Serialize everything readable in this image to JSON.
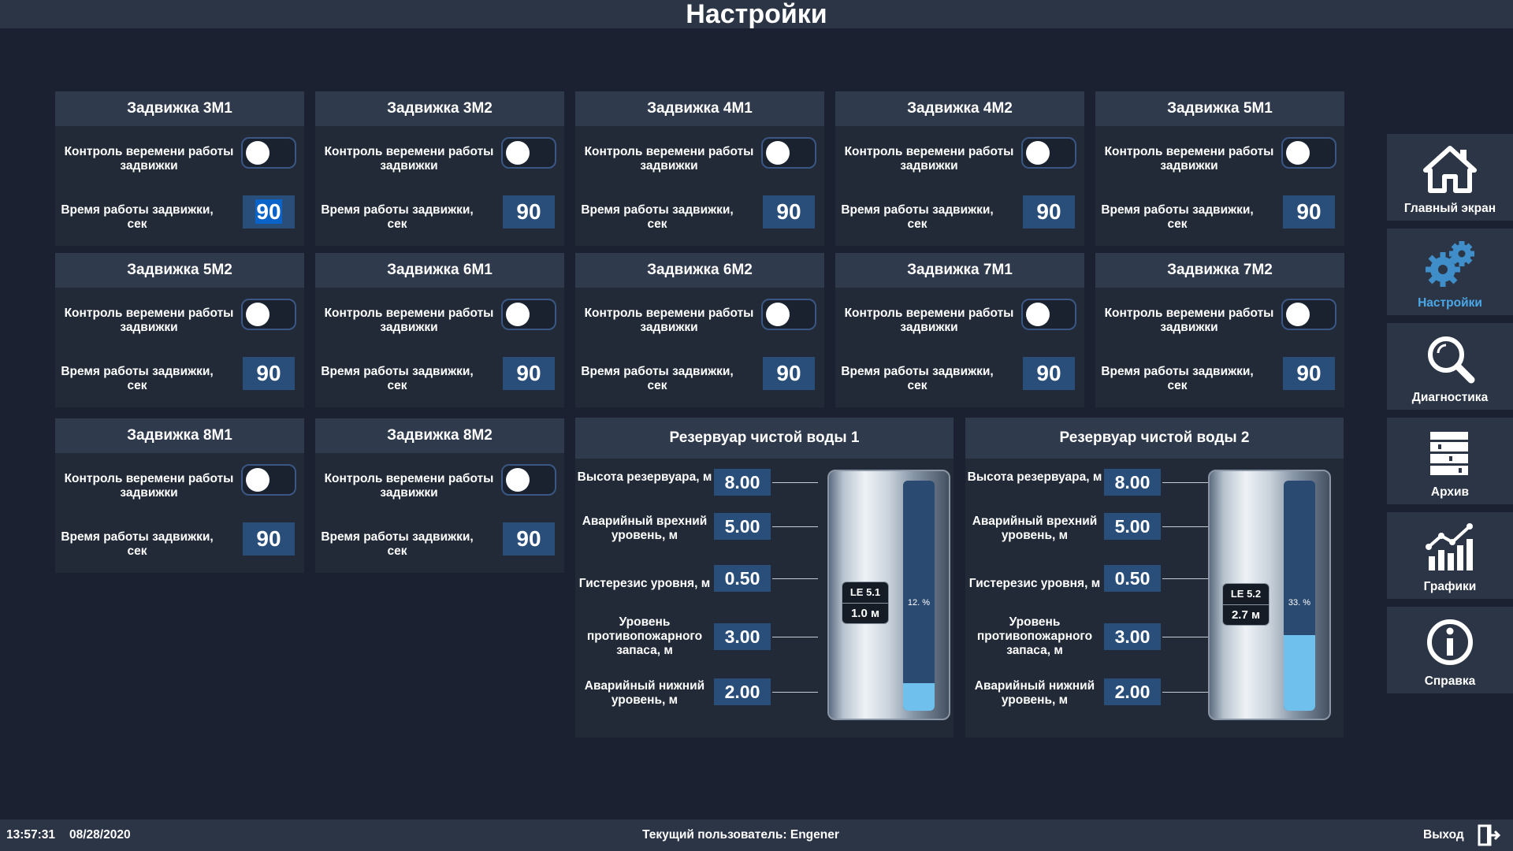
{
  "title": "Настройки",
  "valves": [
    {
      "name": "Задвижка 3М1",
      "control_label": "Контроль веремени работы задвижки",
      "time_label": "Время работы задвижки, сек",
      "time_value": "90",
      "editing": true
    },
    {
      "name": "Задвижка 3М2",
      "control_label": "Контроль веремени работы задвижки",
      "time_label": "Время работы задвижки, сек",
      "time_value": "90"
    },
    {
      "name": "Задвижка 4М1",
      "control_label": "Контроль веремени работы задвижки",
      "time_label": "Время работы задвижки, сек",
      "time_value": "90"
    },
    {
      "name": "Задвижка 4М2",
      "control_label": "Контроль веремени работы задвижки",
      "time_label": "Время работы задвижки, сек",
      "time_value": "90"
    },
    {
      "name": "Задвижка 5М1",
      "control_label": "Контроль веремени работы задвижки",
      "time_label": "Время работы задвижки, сек",
      "time_value": "90"
    },
    {
      "name": "Задвижка 5М2",
      "control_label": "Контроль веремени работы задвижки",
      "time_label": "Время работы задвижки, сек",
      "time_value": "90"
    },
    {
      "name": "Задвижка 6М1",
      "control_label": "Контроль веремени работы задвижки",
      "time_label": "Время работы задвижки, сек",
      "time_value": "90"
    },
    {
      "name": "Задвижка 6М2",
      "control_label": "Контроль веремени работы задвижки",
      "time_label": "Время работы задвижки, сек",
      "time_value": "90"
    },
    {
      "name": "Задвижка 7М1",
      "control_label": "Контроль веремени работы задвижки",
      "time_label": "Время работы задвижки, сек",
      "time_value": "90"
    },
    {
      "name": "Задвижка 7М2",
      "control_label": "Контроль веремени работы задвижки",
      "time_label": "Время работы задвижки, сек",
      "time_value": "90"
    },
    {
      "name": "Задвижка 8М1",
      "control_label": "Контроль веремени работы задвижки",
      "time_label": "Время работы задвижки, сек",
      "time_value": "90"
    },
    {
      "name": "Задвижка 8М2",
      "control_label": "Контроль веремени работы задвижки",
      "time_label": "Время работы задвижки, сек",
      "time_value": "90"
    }
  ],
  "reservoirs": [
    {
      "name": "Резервуар чистой воды 1",
      "params": [
        {
          "label": "Высота резервуара, м",
          "value": "8.00"
        },
        {
          "label": "Аварийный врехний уровень, м",
          "value": "5.00"
        },
        {
          "label": "Гистерезис уровня, м",
          "value": "0.50"
        },
        {
          "label": "Уровень противопожарного запаса, м",
          "value": "3.00"
        },
        {
          "label": "Аварийный нижний уровень, м",
          "value": "2.00"
        }
      ],
      "sensor": "LE 5.1",
      "level": "1.0 м",
      "percent_label": "12. %",
      "fill_fraction": 0.12
    },
    {
      "name": "Резервуар чистой воды 2",
      "params": [
        {
          "label": "Высота резервуара, м",
          "value": "8.00"
        },
        {
          "label": "Аварийный врехний уровень, м",
          "value": "5.00"
        },
        {
          "label": "Гистерезис уровня, м",
          "value": "0.50"
        },
        {
          "label": "Уровень противопожарного запаса, м",
          "value": "3.00"
        },
        {
          "label": "Аварийный нижний уровень, м",
          "value": "2.00"
        }
      ],
      "sensor": "LE 5.2",
      "level": "2.7 м",
      "percent_label": "33. %",
      "fill_fraction": 0.33
    }
  ],
  "nav": [
    {
      "label": "Главный экран",
      "icon": "home-icon"
    },
    {
      "label": "Настройки",
      "icon": "gears-icon",
      "active": true
    },
    {
      "label": "Диагностика",
      "icon": "magnifier-icon"
    },
    {
      "label": "Архив",
      "icon": "archive-icon"
    },
    {
      "label": "Графики",
      "icon": "chart-icon"
    },
    {
      "label": "Справка",
      "icon": "info-icon"
    }
  ],
  "footer": {
    "time": "13:57:31",
    "date": "08/28/2020",
    "user": "Текущий пользователь: Engener",
    "exit": "Выход"
  },
  "colors": {
    "accent": "#4aa8e8",
    "value_box": "#2a4e7a",
    "fill": "#6fc0ec"
  }
}
